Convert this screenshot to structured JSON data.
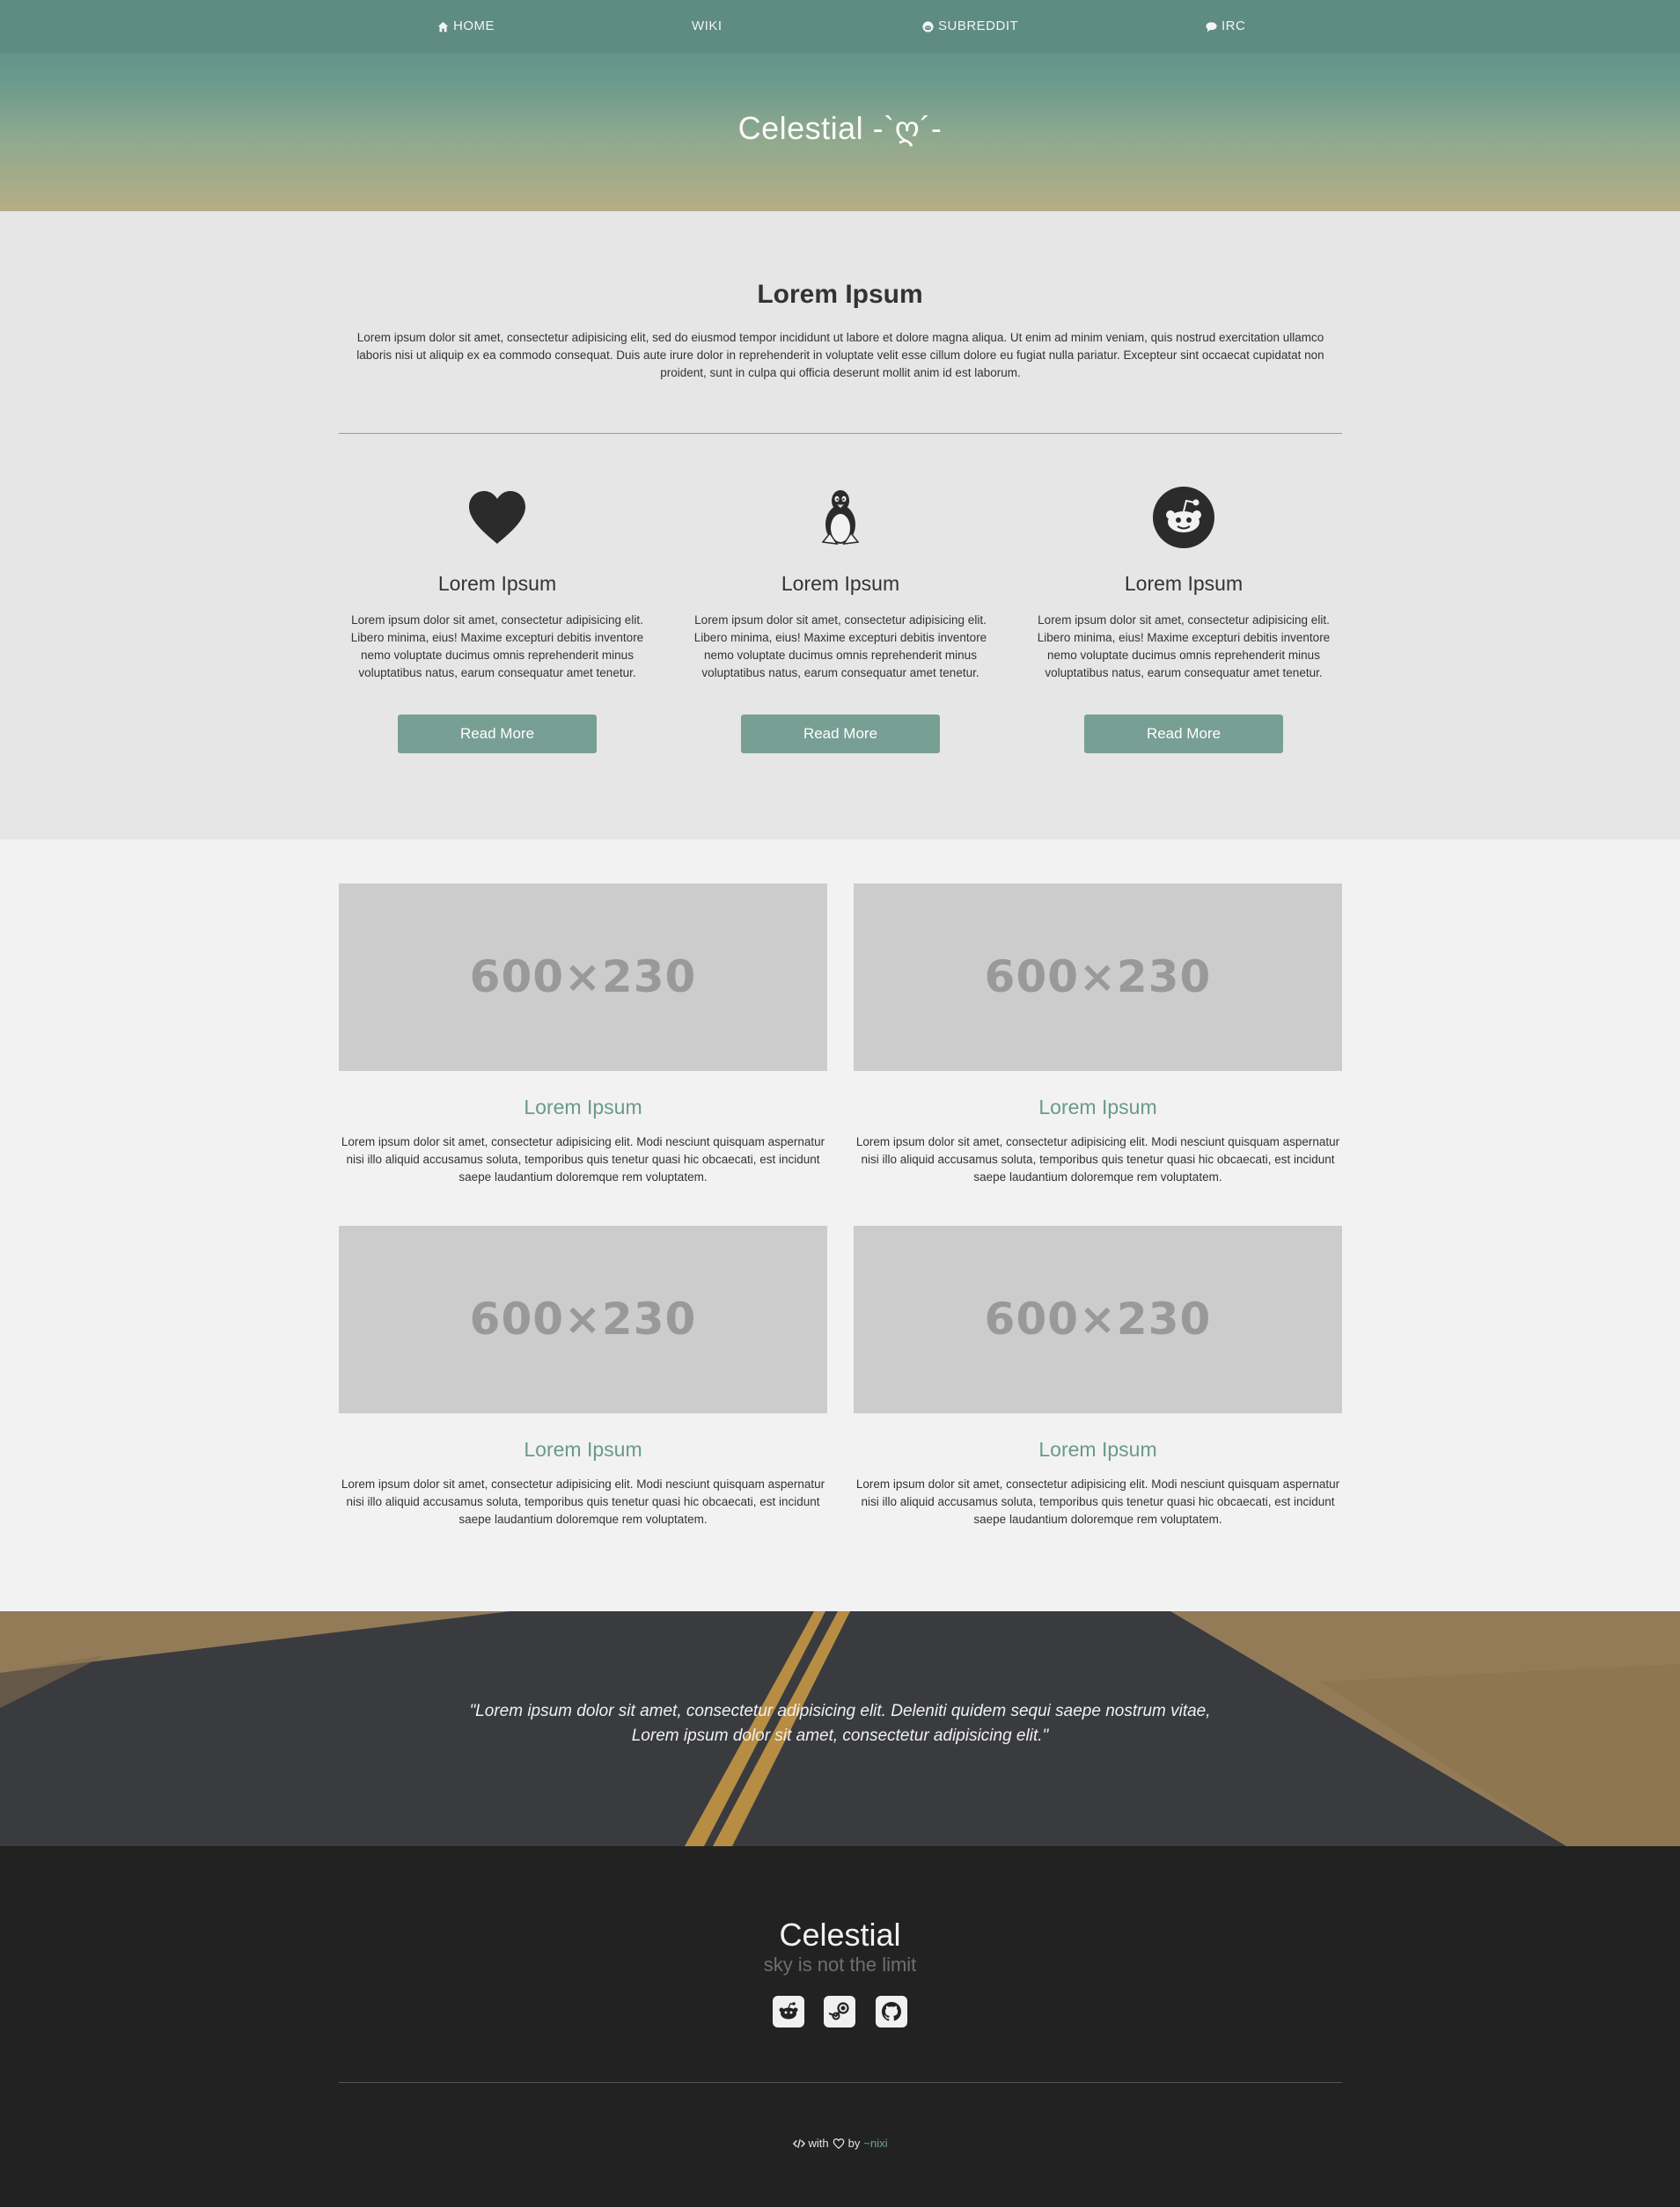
{
  "nav": {
    "home": "HOME",
    "wiki": "WIKI",
    "subreddit": "SUBREDDIT",
    "irc": "IRC"
  },
  "hero": {
    "title": "Celestial -`ღ´-"
  },
  "intro": {
    "title": "Lorem Ipsum",
    "text": "Lorem ipsum dolor sit amet, consectetur adipisicing elit, sed do eiusmod tempor incididunt ut labore et dolore magna aliqua. Ut enim ad minim veniam, quis nostrud exercitation ullamco laboris nisi ut aliquip ex ea commodo consequat. Duis aute irure dolor in reprehenderit in voluptate velit esse cillum dolore eu fugiat nulla pariatur. Excepteur sint occaecat cupidatat non proident, sunt in culpa qui officia deserunt mollit anim id est laborum."
  },
  "features": [
    {
      "icon": "heart-icon",
      "title": "Lorem Ipsum",
      "text": "Lorem ipsum dolor sit amet, consectetur adipisicing elit. Libero minima, eius! Maxime excepturi debitis inventore nemo voluptate ducimus omnis reprehenderit minus voluptatibus natus, earum consequatur amet tenetur.",
      "button": "Read More"
    },
    {
      "icon": "linux-penguin-icon",
      "title": "Lorem Ipsum",
      "text": "Lorem ipsum dolor sit amet, consectetur adipisicing elit. Libero minima, eius! Maxime excepturi debitis inventore nemo voluptate ducimus omnis reprehenderit minus voluptatibus natus, earum consequatur amet tenetur.",
      "button": "Read More"
    },
    {
      "icon": "reddit-icon",
      "title": "Lorem Ipsum",
      "text": "Lorem ipsum dolor sit amet, consectetur adipisicing elit. Libero minima, eius! Maxime excepturi debitis inventore nemo voluptate ducimus omnis reprehenderit minus voluptatibus natus, earum consequatur amet tenetur.",
      "button": "Read More"
    }
  ],
  "cards": [
    {
      "image": "600×230",
      "title": "Lorem Ipsum",
      "text": "Lorem ipsum dolor sit amet, consectetur adipisicing elit. Modi nesciunt quisquam aspernatur nisi illo aliquid accusamus soluta, temporibus quis tenetur quasi hic obcaecati, est incidunt saepe laudantium doloremque rem voluptatem."
    },
    {
      "image": "600×230",
      "title": "Lorem Ipsum",
      "text": "Lorem ipsum dolor sit amet, consectetur adipisicing elit. Modi nesciunt quisquam aspernatur nisi illo aliquid accusamus soluta, temporibus quis tenetur quasi hic obcaecati, est incidunt saepe laudantium doloremque rem voluptatem."
    },
    {
      "image": "600×230",
      "title": "Lorem Ipsum",
      "text": "Lorem ipsum dolor sit amet, consectetur adipisicing elit. Modi nesciunt quisquam aspernatur nisi illo aliquid accusamus soluta, temporibus quis tenetur quasi hic obcaecati, est incidunt saepe laudantium doloremque rem voluptatem."
    },
    {
      "image": "600×230",
      "title": "Lorem Ipsum",
      "text": "Lorem ipsum dolor sit amet, consectetur adipisicing elit. Modi nesciunt quisquam aspernatur nisi illo aliquid accusamus soluta, temporibus quis tenetur quasi hic obcaecati, est incidunt saepe laudantium doloremque rem voluptatem."
    }
  ],
  "quote": {
    "line1": "\"Lorem ipsum dolor sit amet, consectetur adipisicing elit. Deleniti quidem sequi saepe nostrum vitae,",
    "line2": "Lorem ipsum dolor sit amet, consectetur adipisicing elit.\""
  },
  "footer": {
    "title": "Celestial",
    "subtitle": "sky is not the limit",
    "social": [
      "reddit-icon",
      "steam-icon",
      "github-icon"
    ],
    "credit_with": "with",
    "credit_by": "by",
    "credit_author": "~nixi"
  },
  "colors": {
    "accent": "#789f93",
    "card_title": "#6a9a8b",
    "footer_bg": "#222222",
    "nav_bg": "#5e8b82"
  }
}
